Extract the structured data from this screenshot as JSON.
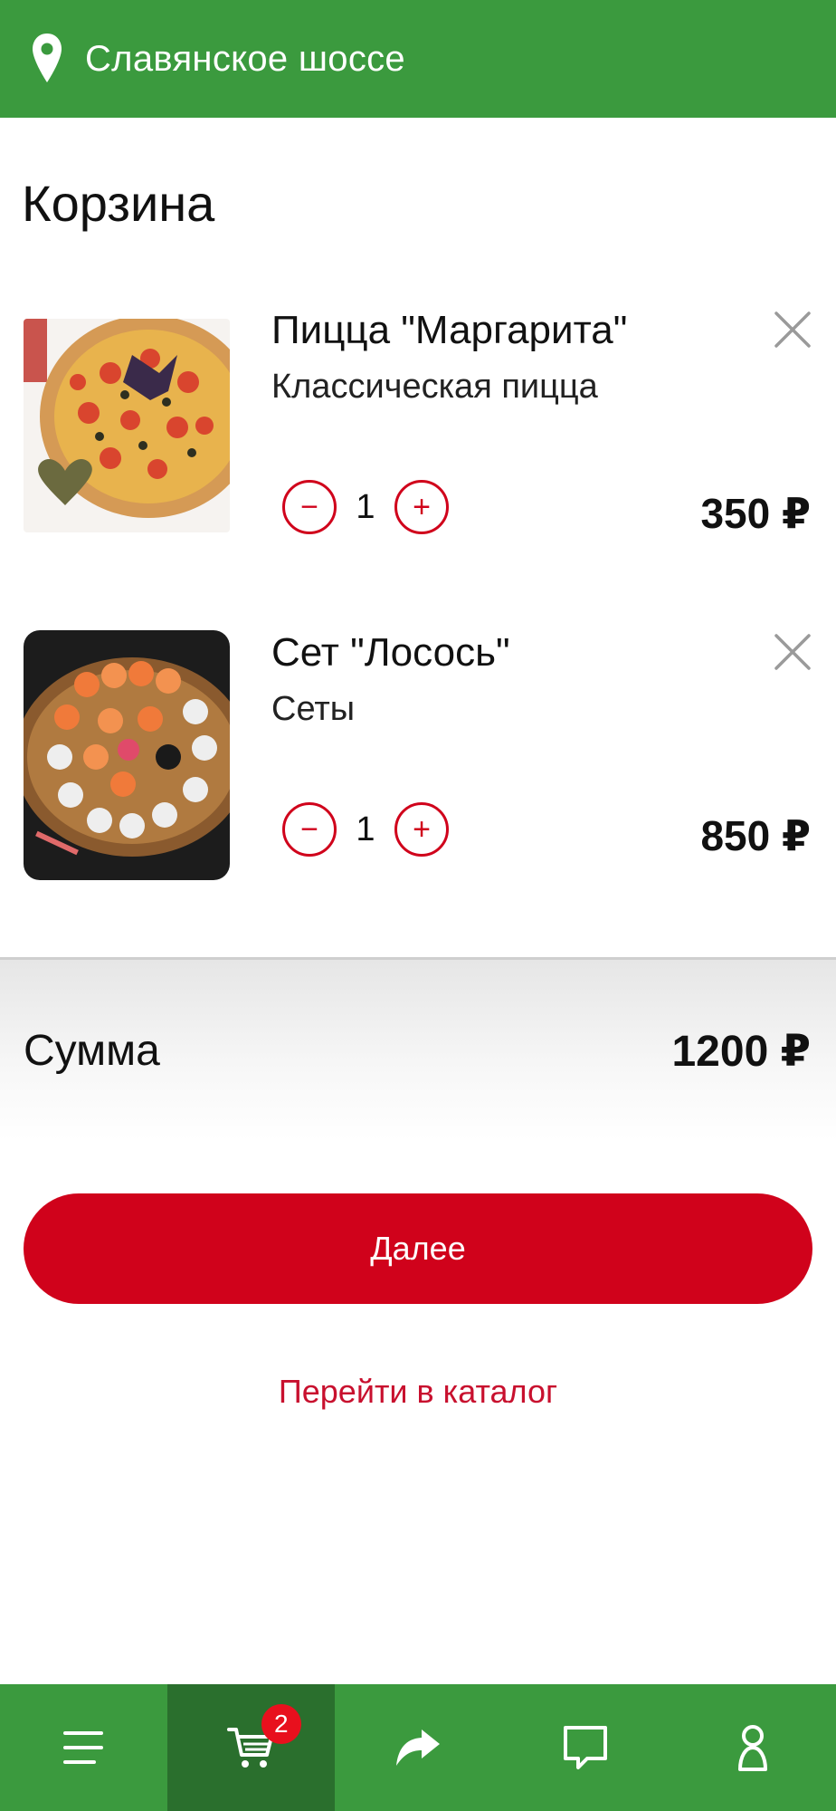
{
  "header": {
    "address": "Славянское шоссе",
    "location_icon": "location-pin-icon"
  },
  "page": {
    "title": "Корзина"
  },
  "cart": {
    "items": [
      {
        "name": "Пицца \"Маргарита\"",
        "category": "Классическая пицца",
        "quantity": "1",
        "price": "350 ₽",
        "minus": "−",
        "plus": "+"
      },
      {
        "name": "Сет \"Лосось\"",
        "category": "Сеты",
        "quantity": "1",
        "price": "850 ₽",
        "minus": "−",
        "plus": "+"
      }
    ],
    "sum_label": "Сумма",
    "sum_value": "1200 ₽"
  },
  "actions": {
    "next_label": "Далее",
    "catalog_link": "Перейти в каталог"
  },
  "tabbar": {
    "tabs": [
      {
        "icon": "menu-icon"
      },
      {
        "icon": "cart-icon",
        "badge": "2",
        "active": true
      },
      {
        "icon": "share-icon"
      },
      {
        "icon": "chat-icon"
      },
      {
        "icon": "profile-icon"
      }
    ]
  },
  "colors": {
    "green": "#3b9a3e",
    "green_active": "#2a6f2d",
    "red": "#d0021b"
  }
}
